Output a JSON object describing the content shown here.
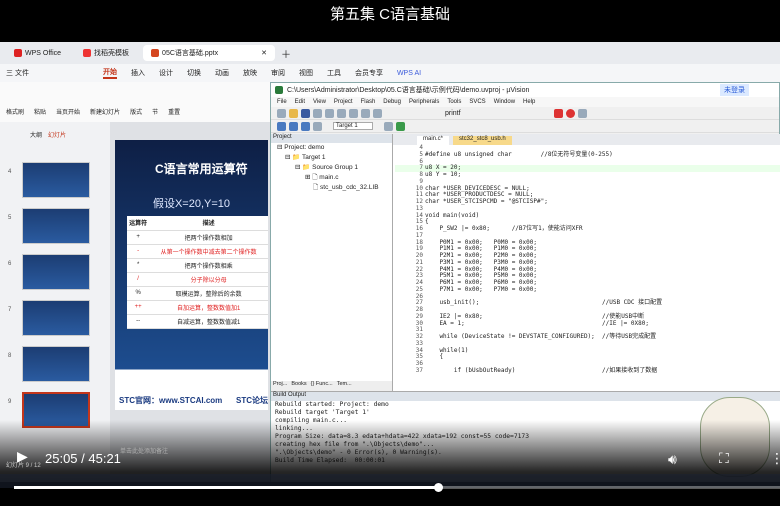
{
  "video": {
    "title": "第五集 C语言基础",
    "current_time": "25:05",
    "duration": "45:21",
    "time_display": "25:05 / 45:21",
    "progress": 0.553
  },
  "wps": {
    "tabs": [
      "WPS Office",
      "找稻壳模板",
      "05C语言基础.pptx"
    ],
    "menu": [
      "三 文件",
      "开始",
      "插入",
      "设计",
      "切换",
      "动画",
      "放映",
      "审阅",
      "视图",
      "工具",
      "会员专享",
      "WPS AI"
    ],
    "ribbon": [
      "格式刷",
      "粘贴",
      "当页开始",
      "新建幻灯片",
      "版式",
      "节",
      "重置"
    ],
    "panel_tabs": [
      "大纲",
      "幻灯片"
    ],
    "slide_numbers": [
      "4",
      "5",
      "6",
      "7",
      "8",
      "9"
    ],
    "status": "幻灯片 9 / 12",
    "notes_hint": "单击此处添加备注",
    "slide": {
      "title": "C语言常用运算符",
      "assume": "假设X=20,Y=10",
      "headers": [
        "运算符",
        "描述"
      ],
      "rows": [
        [
          "+",
          "把两个操作数相加"
        ],
        [
          "-",
          "从第一个操作数中减去第二个操作数"
        ],
        [
          "*",
          "把两个操作数相乘"
        ],
        [
          "/",
          "分子除以分母"
        ],
        [
          "%",
          "取模运算，整除后的余数"
        ],
        [
          "++",
          "自加运算，整数数值加1"
        ],
        [
          "--",
          "自减运算，整数数值减1"
        ]
      ],
      "footer_left": "STC官网：www.STCAI.com",
      "footer_right": "STC论坛"
    }
  },
  "uvision": {
    "title": "C:\\Users\\Administrator\\Desktop\\05.C语言基础\\示例代码\\demo.uvproj - µVision",
    "menu": [
      "File",
      "Edit",
      "View",
      "Project",
      "Flash",
      "Debug",
      "Peripherals",
      "Tools",
      "SVCS",
      "Window",
      "Help"
    ],
    "printf": "printf",
    "target": "Target 1",
    "login": "未登录",
    "project": {
      "header": "Project",
      "items": [
        "Project: demo",
        "Target 1",
        "Source Group 1",
        "main.c",
        "stc_usb_cdc_32.LIB"
      ],
      "tabs": [
        "Proj...",
        "Books",
        "{} Func...",
        "Tem..."
      ]
    },
    "editor_tabs": [
      "main.c*",
      "stc32_stc8_usb.h"
    ],
    "code": [
      [
        "4",
        ""
      ],
      [
        "5",
        "#define u8 unsigned char        //8位无符号变量(0-255)"
      ],
      [
        "6",
        ""
      ],
      [
        "7",
        "u8 X = 20;"
      ],
      [
        "8",
        "u8 Y = 10;"
      ],
      [
        "9",
        ""
      ],
      [
        "10",
        "char *USER_DEVICEDESC = NULL;"
      ],
      [
        "11",
        "char *USER_PRODUCTDESC = NULL;"
      ],
      [
        "12",
        "char *USER_STCISPCMD = \"@STCISP#\";"
      ],
      [
        "13",
        ""
      ],
      [
        "14",
        "void main(void)"
      ],
      [
        "15",
        "{"
      ],
      [
        "16",
        "    P_SW2 |= 0x80;      //B7位写1，使能访问XFR"
      ],
      [
        "17",
        ""
      ],
      [
        "18",
        "    P0M1 = 0x00;   P0M0 = 0x00;"
      ],
      [
        "19",
        "    P1M1 = 0x00;   P1M0 = 0x00;"
      ],
      [
        "20",
        "    P2M1 = 0x00;   P2M0 = 0x00;"
      ],
      [
        "21",
        "    P3M1 = 0x00;   P3M0 = 0x00;"
      ],
      [
        "22",
        "    P4M1 = 0x00;   P4M0 = 0x00;"
      ],
      [
        "23",
        "    P5M1 = 0x00;   P5M0 = 0x00;"
      ],
      [
        "24",
        "    P6M1 = 0x00;   P6M0 = 0x00;"
      ],
      [
        "25",
        "    P7M1 = 0x00;   P7M0 = 0x00;"
      ],
      [
        "26",
        ""
      ],
      [
        "27",
        "    usb_init();                                  //USB CDC 接口配置"
      ],
      [
        "28",
        ""
      ],
      [
        "29",
        "    IE2 |= 0x80;                                 //使能USB中断"
      ],
      [
        "30",
        "    EA = 1;                                      //IE |= 0X80;"
      ],
      [
        "31",
        ""
      ],
      [
        "32",
        "    while (DeviceState != DEVSTATE_CONFIGURED);  //等待USB完成配置"
      ],
      [
        "33",
        ""
      ],
      [
        "34",
        "    while(1)"
      ],
      [
        "35",
        "    {"
      ],
      [
        "36",
        ""
      ],
      [
        "37",
        "        if (bUsbOutReady)                        //如果接收到了数据"
      ]
    ],
    "build": {
      "header": "Build Output",
      "lines": [
        "Rebuild started: Project: demo",
        "Rebuild target 'Target 1'",
        "compiling main.c...",
        "linking...",
        "Program Size: data=8.3 edata+hdata=422 xdata=192 const=55 code=7173",
        "creating hex file from \".\\Objects\\demo\"...",
        "\".\\Objects\\demo\" - 0 Error(s), 0 Warning(s).",
        "Build Time Elapsed:  00:00:01"
      ]
    }
  },
  "colors": {
    "accent": "#c4361b",
    "progress": "#ffffff"
  }
}
